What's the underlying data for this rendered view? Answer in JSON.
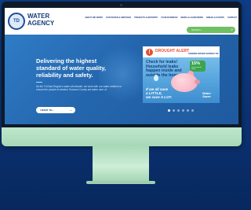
{
  "header": {
    "logo_badge": "TD",
    "logo_text": "WATER\nAGENCY",
    "nav": [
      "ABOUT WE WORK",
      "OUR WATER & SERVICES",
      "PROJECTS & REPORTS",
      "YOUR BUSINESS",
      "NEWS & LEARN MORE",
      "BREAK & EVENTS",
      "CONTACT"
    ],
    "search_placeholder": "SEARCH"
  },
  "hero": {
    "title": "Delivering the highest\nstandard of water quality,\nreliability and safety.",
    "body": "As the Tri-Dam Region's water wholesaler, we work with our water retailers to ensure the people of western Sonoma County are taken care of.",
    "cta_label": "I WANT TO..."
  },
  "promo": {
    "alert_label": "DROUGHT ALERT",
    "brand": "SONOMA WATER SAVINGS TIP",
    "message": "Check for leaks!\nHousehold leaks\nhappen inside and\noutside the home.",
    "badge_value": "15%",
    "badge_sub": "of household water",
    "tagline": "If we all save\na LITTLE,\nwe save A LOT.",
    "signature": "Water\nSaver"
  },
  "carousel": {
    "dot_count": 6,
    "active_index": 0
  },
  "colors": {
    "brand_blue": "#163c7a",
    "accent_green": "#6fbf63",
    "alert_red": "#e94f2c"
  }
}
